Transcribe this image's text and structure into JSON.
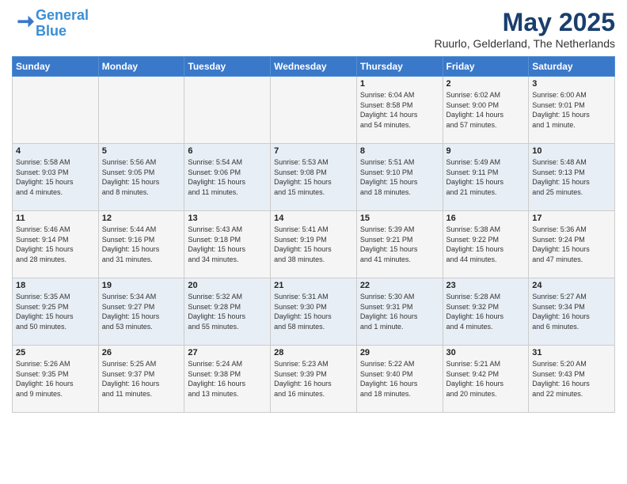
{
  "logo": {
    "line1": "General",
    "line2": "Blue"
  },
  "title": "May 2025",
  "subtitle": "Ruurlo, Gelderland, The Netherlands",
  "weekdays": [
    "Sunday",
    "Monday",
    "Tuesday",
    "Wednesday",
    "Thursday",
    "Friday",
    "Saturday"
  ],
  "weeks": [
    [
      {
        "day": "",
        "info": ""
      },
      {
        "day": "",
        "info": ""
      },
      {
        "day": "",
        "info": ""
      },
      {
        "day": "",
        "info": ""
      },
      {
        "day": "1",
        "info": "Sunrise: 6:04 AM\nSunset: 8:58 PM\nDaylight: 14 hours\nand 54 minutes."
      },
      {
        "day": "2",
        "info": "Sunrise: 6:02 AM\nSunset: 9:00 PM\nDaylight: 14 hours\nand 57 minutes."
      },
      {
        "day": "3",
        "info": "Sunrise: 6:00 AM\nSunset: 9:01 PM\nDaylight: 15 hours\nand 1 minute."
      }
    ],
    [
      {
        "day": "4",
        "info": "Sunrise: 5:58 AM\nSunset: 9:03 PM\nDaylight: 15 hours\nand 4 minutes."
      },
      {
        "day": "5",
        "info": "Sunrise: 5:56 AM\nSunset: 9:05 PM\nDaylight: 15 hours\nand 8 minutes."
      },
      {
        "day": "6",
        "info": "Sunrise: 5:54 AM\nSunset: 9:06 PM\nDaylight: 15 hours\nand 11 minutes."
      },
      {
        "day": "7",
        "info": "Sunrise: 5:53 AM\nSunset: 9:08 PM\nDaylight: 15 hours\nand 15 minutes."
      },
      {
        "day": "8",
        "info": "Sunrise: 5:51 AM\nSunset: 9:10 PM\nDaylight: 15 hours\nand 18 minutes."
      },
      {
        "day": "9",
        "info": "Sunrise: 5:49 AM\nSunset: 9:11 PM\nDaylight: 15 hours\nand 21 minutes."
      },
      {
        "day": "10",
        "info": "Sunrise: 5:48 AM\nSunset: 9:13 PM\nDaylight: 15 hours\nand 25 minutes."
      }
    ],
    [
      {
        "day": "11",
        "info": "Sunrise: 5:46 AM\nSunset: 9:14 PM\nDaylight: 15 hours\nand 28 minutes."
      },
      {
        "day": "12",
        "info": "Sunrise: 5:44 AM\nSunset: 9:16 PM\nDaylight: 15 hours\nand 31 minutes."
      },
      {
        "day": "13",
        "info": "Sunrise: 5:43 AM\nSunset: 9:18 PM\nDaylight: 15 hours\nand 34 minutes."
      },
      {
        "day": "14",
        "info": "Sunrise: 5:41 AM\nSunset: 9:19 PM\nDaylight: 15 hours\nand 38 minutes."
      },
      {
        "day": "15",
        "info": "Sunrise: 5:39 AM\nSunset: 9:21 PM\nDaylight: 15 hours\nand 41 minutes."
      },
      {
        "day": "16",
        "info": "Sunrise: 5:38 AM\nSunset: 9:22 PM\nDaylight: 15 hours\nand 44 minutes."
      },
      {
        "day": "17",
        "info": "Sunrise: 5:36 AM\nSunset: 9:24 PM\nDaylight: 15 hours\nand 47 minutes."
      }
    ],
    [
      {
        "day": "18",
        "info": "Sunrise: 5:35 AM\nSunset: 9:25 PM\nDaylight: 15 hours\nand 50 minutes."
      },
      {
        "day": "19",
        "info": "Sunrise: 5:34 AM\nSunset: 9:27 PM\nDaylight: 15 hours\nand 53 minutes."
      },
      {
        "day": "20",
        "info": "Sunrise: 5:32 AM\nSunset: 9:28 PM\nDaylight: 15 hours\nand 55 minutes."
      },
      {
        "day": "21",
        "info": "Sunrise: 5:31 AM\nSunset: 9:30 PM\nDaylight: 15 hours\nand 58 minutes."
      },
      {
        "day": "22",
        "info": "Sunrise: 5:30 AM\nSunset: 9:31 PM\nDaylight: 16 hours\nand 1 minute."
      },
      {
        "day": "23",
        "info": "Sunrise: 5:28 AM\nSunset: 9:32 PM\nDaylight: 16 hours\nand 4 minutes."
      },
      {
        "day": "24",
        "info": "Sunrise: 5:27 AM\nSunset: 9:34 PM\nDaylight: 16 hours\nand 6 minutes."
      }
    ],
    [
      {
        "day": "25",
        "info": "Sunrise: 5:26 AM\nSunset: 9:35 PM\nDaylight: 16 hours\nand 9 minutes."
      },
      {
        "day": "26",
        "info": "Sunrise: 5:25 AM\nSunset: 9:37 PM\nDaylight: 16 hours\nand 11 minutes."
      },
      {
        "day": "27",
        "info": "Sunrise: 5:24 AM\nSunset: 9:38 PM\nDaylight: 16 hours\nand 13 minutes."
      },
      {
        "day": "28",
        "info": "Sunrise: 5:23 AM\nSunset: 9:39 PM\nDaylight: 16 hours\nand 16 minutes."
      },
      {
        "day": "29",
        "info": "Sunrise: 5:22 AM\nSunset: 9:40 PM\nDaylight: 16 hours\nand 18 minutes."
      },
      {
        "day": "30",
        "info": "Sunrise: 5:21 AM\nSunset: 9:42 PM\nDaylight: 16 hours\nand 20 minutes."
      },
      {
        "day": "31",
        "info": "Sunrise: 5:20 AM\nSunset: 9:43 PM\nDaylight: 16 hours\nand 22 minutes."
      }
    ]
  ]
}
